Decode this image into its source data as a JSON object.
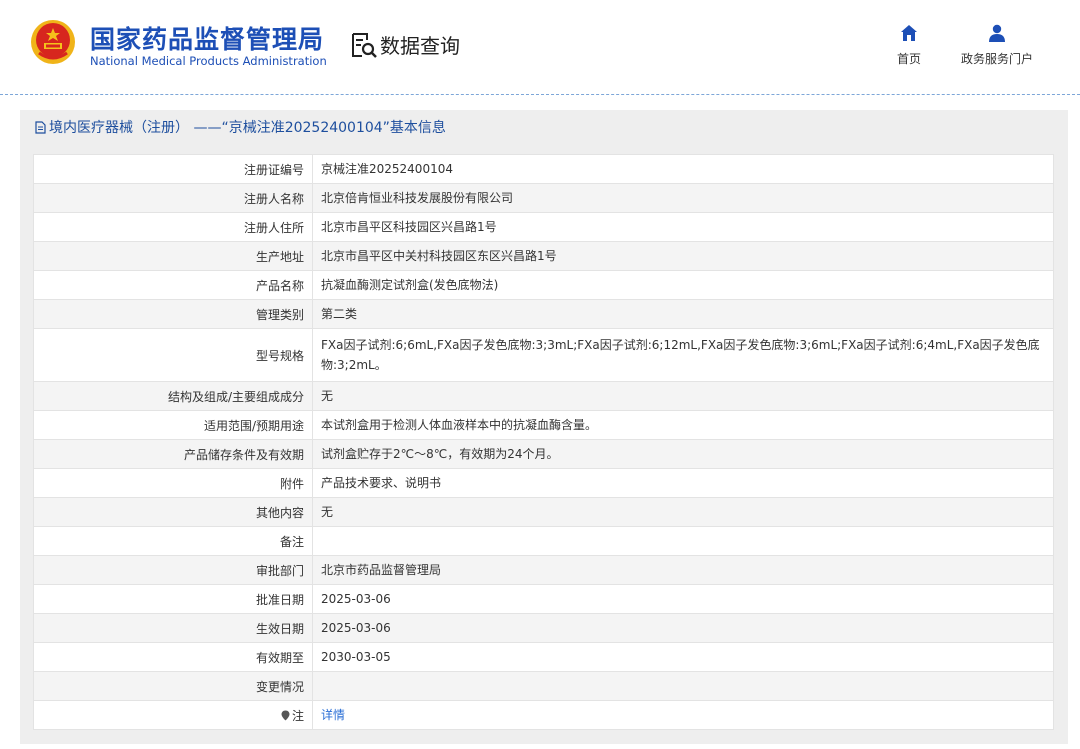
{
  "header": {
    "org_name_cn": "国家药品监督管理局",
    "org_name_en": "National Medical Products Administration",
    "data_query_label": "数据查询",
    "nav": [
      {
        "label": "首页",
        "icon": "home-icon"
      },
      {
        "label": "政务服务门户",
        "icon": "user-icon"
      }
    ]
  },
  "panel": {
    "title": "境内医疗器械（注册） ——“京械注准20252400104”基本信息"
  },
  "rows": [
    {
      "key": "注册证编号",
      "value": "京械注准20252400104"
    },
    {
      "key": "注册人名称",
      "value": "北京倍肯恒业科技发展股份有限公司"
    },
    {
      "key": "注册人住所",
      "value": "北京市昌平区科技园区兴昌路1号"
    },
    {
      "key": "生产地址",
      "value": "北京市昌平区中关村科技园区东区兴昌路1号"
    },
    {
      "key": "产品名称",
      "value": "抗凝血酶测定试剂盒(发色底物法)"
    },
    {
      "key": "管理类别",
      "value": "第二类"
    },
    {
      "key": "型号规格",
      "value": "FXa因子试剂:6;6mL,FXa因子发色底物:3;3mL;FXa因子试剂:6;12mL,FXa因子发色底物:3;6mL;FXa因子试剂:6;4mL,FXa因子发色底物:3;2mL。"
    },
    {
      "key": "结构及组成/主要组成成分",
      "value": "无"
    },
    {
      "key": "适用范围/预期用途",
      "value": "本试剂盒用于检测人体血液样本中的抗凝血酶含量。"
    },
    {
      "key": "产品储存条件及有效期",
      "value": "试剂盒贮存于2℃～8℃，有效期为24个月。"
    },
    {
      "key": "附件",
      "value": "产品技术要求、说明书"
    },
    {
      "key": "其他内容",
      "value": "无"
    },
    {
      "key": "备注",
      "value": ""
    },
    {
      "key": "审批部门",
      "value": "北京市药品监督管理局"
    },
    {
      "key": "批准日期",
      "value": "2025-03-06"
    },
    {
      "key": "生效日期",
      "value": "2025-03-06"
    },
    {
      "key": "有效期至",
      "value": "2030-03-05"
    },
    {
      "key": "变更情况",
      "value": ""
    },
    {
      "key": "注",
      "value": "详情"
    }
  ],
  "colors": {
    "brand_blue": "#1d4fb6",
    "link_blue": "#2b6fd6",
    "panel_gray": "#eeeeee",
    "emblem_red": "#d7261e",
    "emblem_gold": "#f5c21b"
  }
}
